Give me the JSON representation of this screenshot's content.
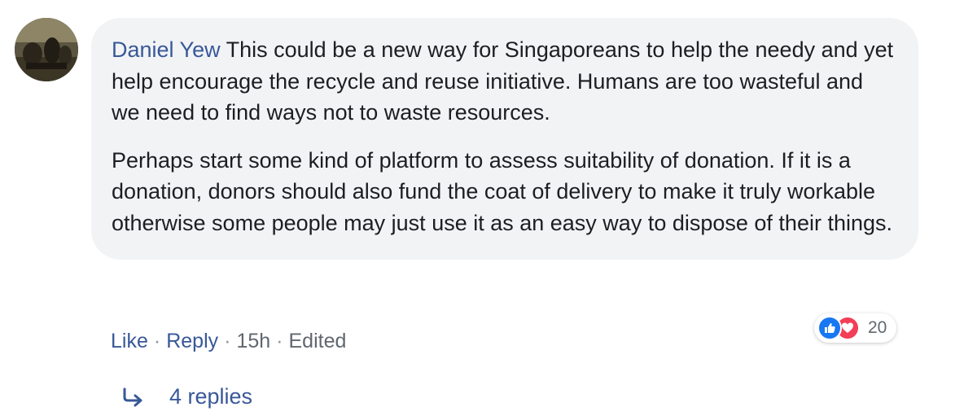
{
  "comment": {
    "author": "Daniel Yew",
    "paragraphs": [
      "This could be a new way for Singaporeans to help the needy and yet help encourage the recycle and reuse initiative. Humans are too wasteful and we need to find ways not to waste resources.",
      "Perhaps start some kind of platform to assess suitability of donation. If it is a donation, donors should also fund the coat of delivery to make it truly workable otherwise some people may just use it as an easy way to dispose of their things."
    ],
    "reactions": {
      "icons": [
        "like-icon",
        "love-icon"
      ],
      "count": "20"
    },
    "actions": {
      "like": "Like",
      "reply": "Reply",
      "time": "15h",
      "edited": "Edited",
      "separator": "·"
    },
    "replies": {
      "label": "4 replies",
      "icon": "reply-arrow-icon"
    }
  },
  "colors": {
    "author_link": "#385898",
    "bubble_bg": "#f2f3f5",
    "like_blue": "#1877f2",
    "love_red": "#f33e58",
    "meta_gray": "#606770"
  }
}
